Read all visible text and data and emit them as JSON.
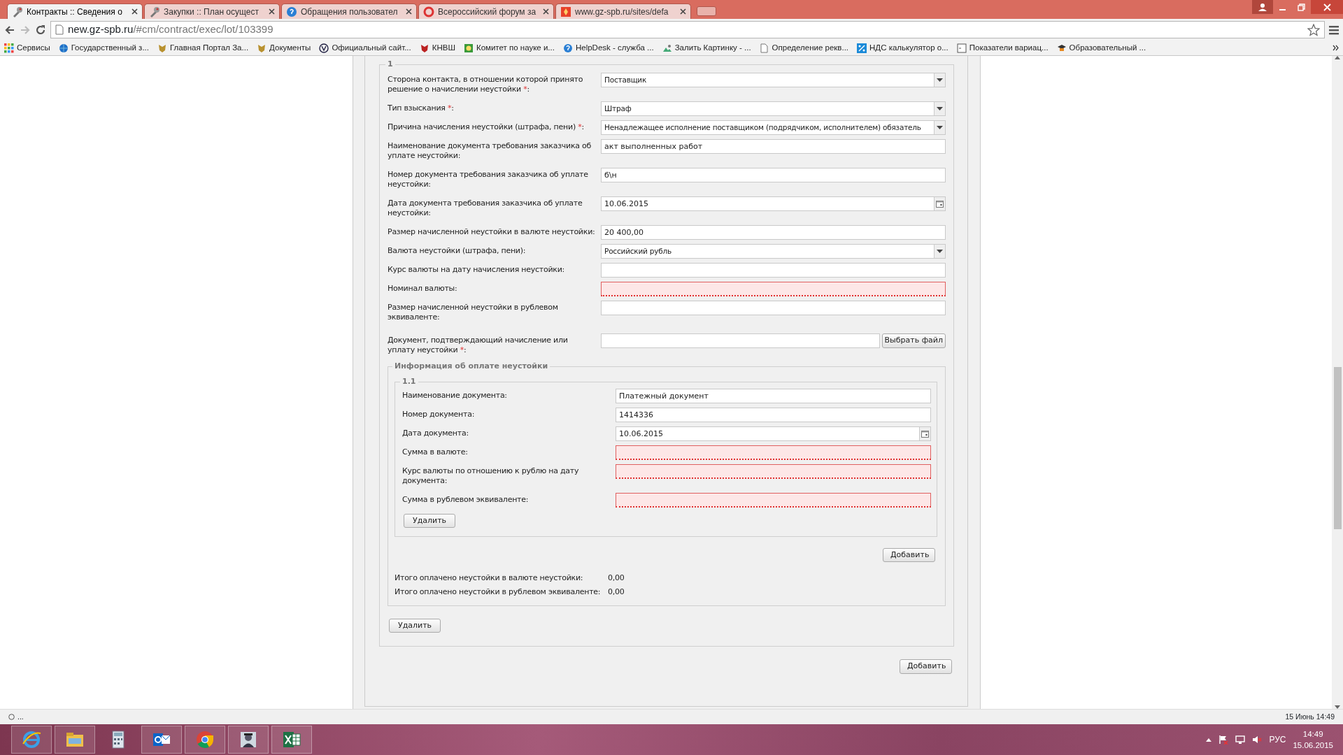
{
  "browser": {
    "tabs": [
      {
        "title": "Контракты :: Сведения о",
        "selected": true
      },
      {
        "title": "Закупки :: План осущест",
        "selected": false
      },
      {
        "title": "Обращения пользовател",
        "selected": false
      },
      {
        "title": "Всероссийский форум за",
        "selected": false
      },
      {
        "title": "www.gz-spb.ru/sites/defa",
        "selected": false
      }
    ],
    "address": {
      "host": "new.gz-spb.ru",
      "path": "/#cm/contract/exec/lot/103399"
    },
    "bookmarks": [
      {
        "label": "Сервисы"
      },
      {
        "label": "Государственный з..."
      },
      {
        "label": "Главная Портал За..."
      },
      {
        "label": "Документы"
      },
      {
        "label": "Официальный сайт..."
      },
      {
        "label": "КНВШ"
      },
      {
        "label": "Комитет по науке и..."
      },
      {
        "label": "HelpDesk - служба ..."
      },
      {
        "label": "Залить Картинку - ..."
      },
      {
        "label": "Определение рекв..."
      },
      {
        "label": "НДС калькулятор о..."
      },
      {
        "label": "Показатели вариац..."
      },
      {
        "label": "Образовательный ..."
      }
    ]
  },
  "form": {
    "section": "1",
    "fields": [
      {
        "kind": "select",
        "label": "Сторона контакта, в отношении которой принято решение о начислении неустойки",
        "required_mark": "*",
        "label_end": ":",
        "value": "Поставщик",
        "invalid": false
      },
      {
        "kind": "select",
        "label": "Тип взыскания",
        "required_mark": "*",
        "label_end": ":",
        "value": "Штраф",
        "invalid": false
      },
      {
        "kind": "select",
        "label": "Причина начисления неустойки (штрафа, пени)",
        "required_mark": "*",
        "label_end": ":",
        "value": "Ненадлежащее исполнение поставщиком (подрядчиком, исполнителем) обязатель",
        "invalid": false
      },
      {
        "kind": "text",
        "label": "Наименование документа требования заказчика об уплате неустойки:",
        "value": "акт выполненных работ",
        "invalid": false
      },
      {
        "kind": "text",
        "label": "Номер документа требования заказчика об уплате неустойки:",
        "value": "б\\н",
        "invalid": false
      },
      {
        "kind": "date",
        "label": "Дата документа требования заказчика об уплате неустойки:",
        "value": "10.06.2015",
        "invalid": false
      },
      {
        "kind": "text",
        "label": "Размер начисленной неустойки в валюте неустойки:",
        "value": "20 400,00",
        "invalid": false
      },
      {
        "kind": "select",
        "label": "Валюта неустойки (штрафа, пени):",
        "value": "Российский рубль",
        "invalid": false
      },
      {
        "kind": "text",
        "label": "Курс валюты на дату начисления неустойки:",
        "invalid": false
      },
      {
        "kind": "text",
        "label": "Номинал валюты:",
        "invalid": true
      },
      {
        "kind": "text",
        "label": "Размер начисленной неустойки в рублевом эквиваленте:",
        "invalid": false
      },
      {
        "kind": "file",
        "label": "Документ, подтверждающий начисление или уплату неустойки",
        "required_mark": "*",
        "label_end": ":",
        "button": "Выбрать файл",
        "invalid": false
      }
    ],
    "payments": {
      "legend": "Информация об оплате неустойки",
      "items": [
        {
          "number": "1.1",
          "fields": [
            {
              "kind": "text",
              "label": "Наименование документа:",
              "value": "Платежный документ",
              "invalid": false
            },
            {
              "kind": "text",
              "label": "Номер документа:",
              "value": "1414336",
              "invalid": false
            },
            {
              "kind": "date",
              "label": "Дата документа:",
              "value": "10.06.2015",
              "invalid": false
            },
            {
              "kind": "text",
              "label": "Сумма в валюте:",
              "invalid": true
            },
            {
              "kind": "text",
              "label": "Курс валюты по отношению к рублю на дату документа:",
              "invalid": true
            },
            {
              "kind": "text",
              "label": "Сумма в рублевом эквиваленте:",
              "invalid": true
            }
          ],
          "delete_label": "Удалить"
        }
      ],
      "add_label": "Добавить",
      "totals": [
        {
          "label": "Итого оплачено неустойки в валюте неустойки:",
          "value": "0,00"
        },
        {
          "label": "Итого оплачено неустойки в рублевом эквиваленте:",
          "value": "0,00"
        }
      ]
    },
    "delete_label": "Удалить",
    "add_label": "Добавить"
  },
  "status_bar": {
    "left": "...",
    "right": "15 Июнь 14:49"
  },
  "taskbar": {
    "apps": [
      {
        "running": true
      },
      {
        "running": true
      },
      {
        "running": false
      },
      {
        "running": true
      },
      {
        "running": true
      },
      {
        "running": true
      },
      {
        "running": true
      }
    ],
    "language": "РУС",
    "time": "14:49",
    "date": "15.06.2015"
  }
}
